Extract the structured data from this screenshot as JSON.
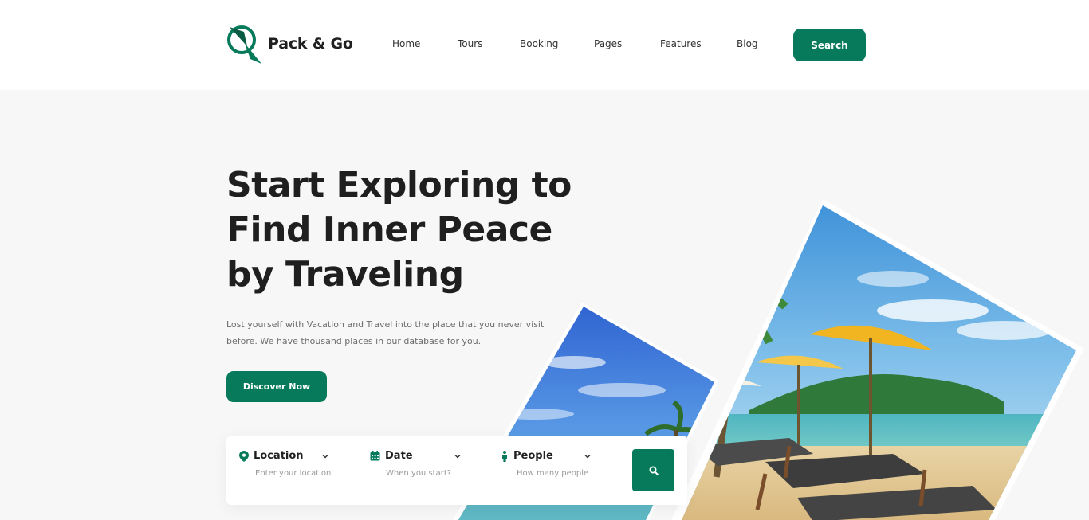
{
  "brand": {
    "name": "Pack & Go",
    "accent": "#067a5a"
  },
  "nav": [
    {
      "label": "Home"
    },
    {
      "label": "Tours"
    },
    {
      "label": "Booking"
    },
    {
      "label": "Pages"
    },
    {
      "label": "Features"
    },
    {
      "label": "Blog"
    }
  ],
  "header": {
    "search_label": "Search"
  },
  "hero": {
    "title_line1": "Start Exploring to",
    "title_line2": "Find Inner Peace",
    "title_line3": "by Traveling",
    "desc_line1": "Lost yourself with Vacation and Travel into the place that you never visit",
    "desc_line2": "before. We have thousand places in our database for you.",
    "cta": "Discover Now"
  },
  "search_bar": {
    "location": {
      "label": "Location",
      "placeholder": "Enter your location",
      "icon": "map-pin-icon"
    },
    "date": {
      "label": "Date",
      "placeholder": "When you start?",
      "icon": "calendar-icon"
    },
    "people": {
      "label": "People",
      "placeholder": "How many people",
      "icon": "person-icon"
    },
    "submit_icon": "search-icon"
  }
}
